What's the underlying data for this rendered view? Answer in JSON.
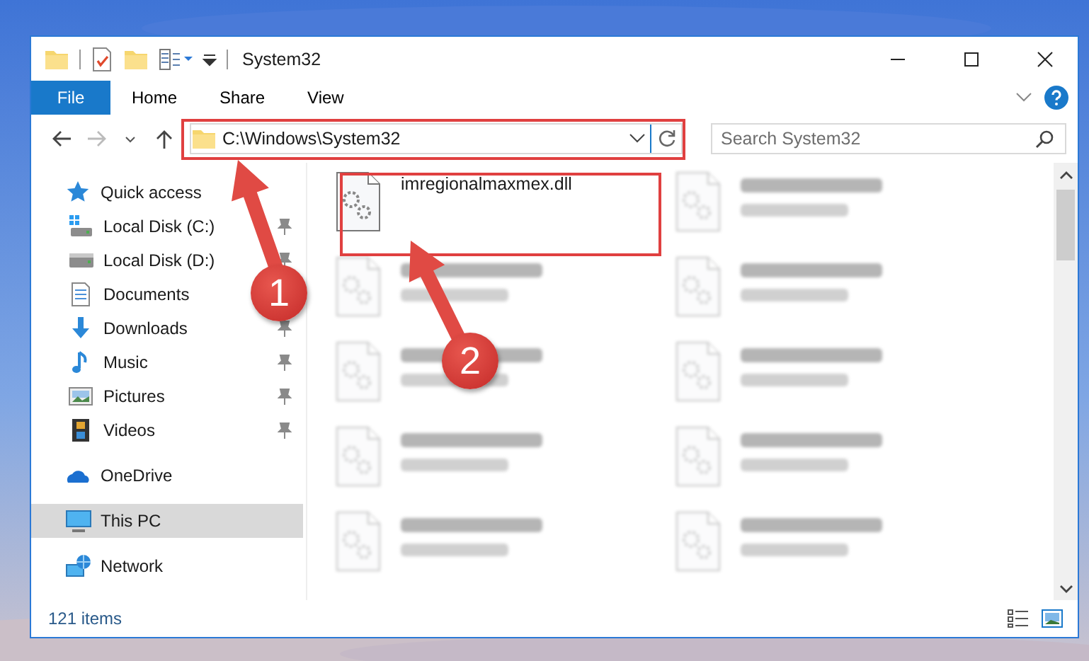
{
  "window": {
    "title": "System32"
  },
  "ribbon": {
    "tabs": [
      {
        "label": "File",
        "kind": "file",
        "selected": false
      },
      {
        "label": "Home",
        "kind": "tab",
        "selected": false
      },
      {
        "label": "Share",
        "kind": "tab",
        "selected": false
      },
      {
        "label": "View",
        "kind": "tab",
        "selected": false
      }
    ]
  },
  "address_bar": {
    "path": "C:\\Windows\\System32"
  },
  "search": {
    "placeholder": "Search System32"
  },
  "sidebar": {
    "items": [
      {
        "label": "Quick access",
        "kind": "star",
        "selected": false,
        "children": [
          {
            "label": "Local Disk (C:)",
            "kind": "system-drive",
            "pinned": true,
            "selected": false
          },
          {
            "label": "Local Disk (D:)",
            "kind": "drive",
            "pinned": true,
            "selected": false
          },
          {
            "label": "Documents",
            "kind": "documents",
            "selected": false
          },
          {
            "label": "Downloads",
            "kind": "downloads",
            "pinned": true,
            "selected": false
          },
          {
            "label": "Music",
            "kind": "music",
            "pinned": true,
            "selected": false
          },
          {
            "label": "Pictures",
            "kind": "pictures",
            "pinned": true,
            "selected": false
          },
          {
            "label": "Videos",
            "kind": "videos",
            "pinned": true,
            "selected": false
          }
        ]
      },
      {
        "label": "OneDrive",
        "kind": "cloud",
        "selected": false
      },
      {
        "label": "This PC",
        "kind": "computer",
        "selected": true
      },
      {
        "label": "Network",
        "kind": "network",
        "selected": false
      }
    ]
  },
  "files": [
    {
      "name": "imregionalmaxmex.dll",
      "blurred": false
    },
    {
      "blurred": true
    },
    {
      "blurred": true
    },
    {
      "blurred": true
    },
    {
      "blurred": true
    },
    {
      "blurred": true
    },
    {
      "blurred": true
    },
    {
      "blurred": true
    },
    {
      "blurred": true
    },
    {
      "blurred": true
    }
  ],
  "status_bar": {
    "count": "121 items"
  },
  "annotations": {
    "badges": [
      {
        "label": "1"
      },
      {
        "label": "2"
      }
    ]
  }
}
